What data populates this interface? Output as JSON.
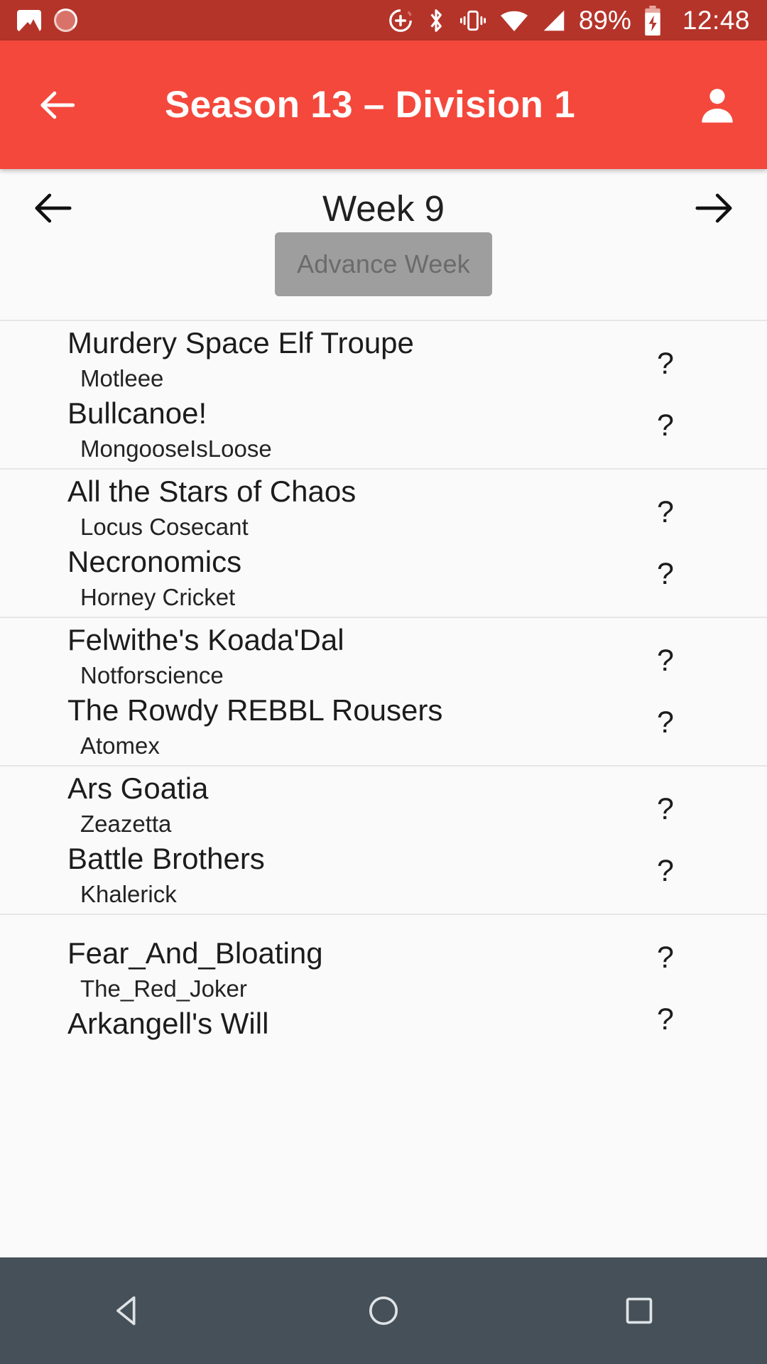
{
  "status_bar": {
    "background": "#b5342a",
    "left_icons": [
      "photo-icon",
      "sync-spinner-icon"
    ],
    "right_icons": [
      "do-not-disturb-icon",
      "bluetooth-icon",
      "vibrate-icon",
      "wifi-icon",
      "cellular-signal-icon"
    ],
    "battery_percent": "89%",
    "battery_state": "charging",
    "clock": "12:48"
  },
  "app_bar": {
    "background": "#f4483c",
    "title": "Season 13 – Division 1",
    "back_icon": "arrow-left-icon",
    "account_icon": "person-icon"
  },
  "week_nav": {
    "prev_icon": "arrow-left-icon",
    "next_icon": "arrow-right-icon",
    "label": "Week 9"
  },
  "advance": {
    "label": "Advance Week",
    "disabled": true,
    "background": "#9e9e9e",
    "text_color": "#6b6b6b"
  },
  "matches": [
    {
      "home": {
        "team": "Murdery Space Elf Troupe",
        "coach": "Motleee",
        "score": "?"
      },
      "away": {
        "team": "Bullcanoe!",
        "coach": "MongooseIsLoose",
        "score": "?"
      }
    },
    {
      "home": {
        "team": "All the Stars of Chaos",
        "coach": "Locus Cosecant",
        "score": "?"
      },
      "away": {
        "team": "Necronomics",
        "coach": "Horney Cricket",
        "score": "?"
      }
    },
    {
      "home": {
        "team": "Felwithe's Koada'Dal",
        "coach": "Notforscience",
        "score": "?"
      },
      "away": {
        "team": "The Rowdy REBBL Rousers",
        "coach": "Atomex",
        "score": "?"
      }
    },
    {
      "home": {
        "team": "Ars Goatia",
        "coach": "Zeazetta",
        "score": "?"
      },
      "away": {
        "team": "Battle Brothers",
        "coach": "Khalerick",
        "score": "?"
      }
    },
    {
      "home": {
        "team": "Fear_And_Bloating",
        "coach": "The_Red_Joker",
        "score": "?"
      },
      "away": {
        "team": "Arkangell's Will",
        "coach": "",
        "score": "?"
      }
    }
  ],
  "nav_bar": {
    "background": "#455058",
    "buttons": [
      "back-triangle-icon",
      "home-circle-icon",
      "recents-square-icon"
    ]
  }
}
